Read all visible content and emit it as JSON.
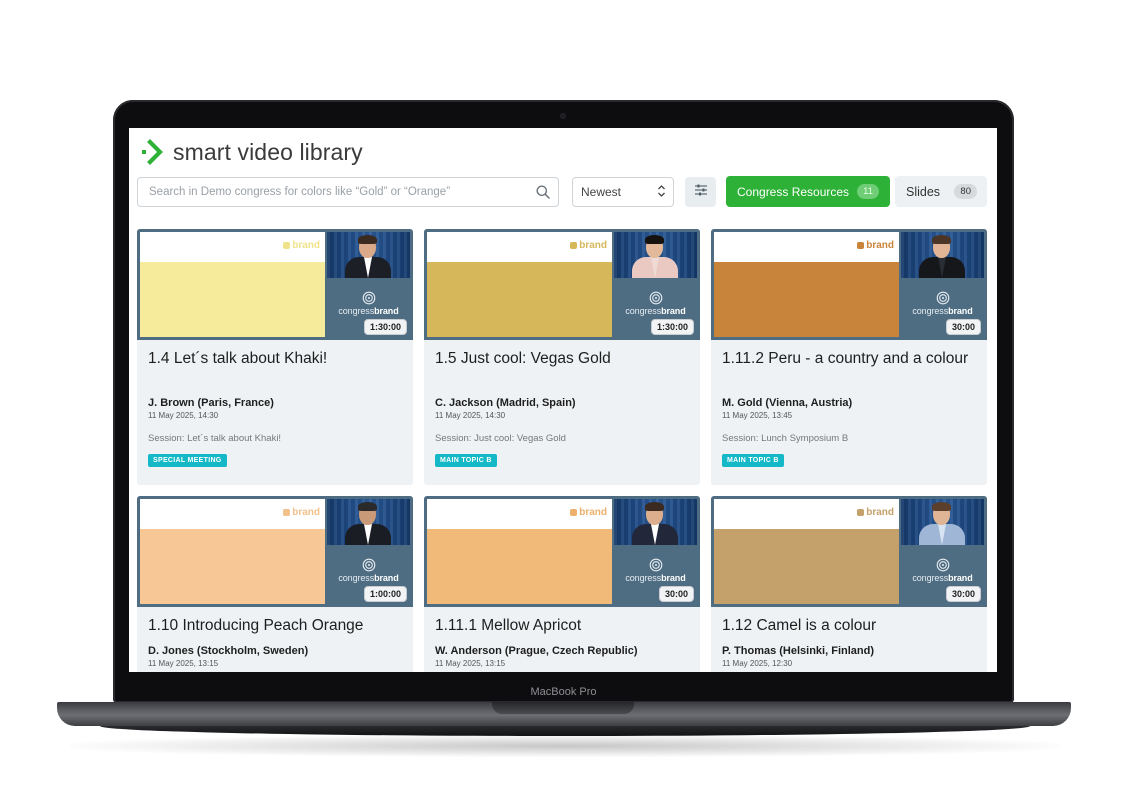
{
  "app": {
    "logo_text": "smart video library",
    "brand_color": "#2db136"
  },
  "device": {
    "label": "MacBook Pro"
  },
  "toolbar": {
    "search_placeholder": "Search in Demo congress for colors like “Gold” or “Orange”",
    "sort_value": "Newest",
    "tabs": [
      {
        "label": "Congress Resources",
        "count": "11",
        "active": true
      },
      {
        "label": "Slides",
        "count": "80",
        "active": false
      }
    ]
  },
  "cards": [
    {
      "title": "1.4 Let´s talk about Khaki!",
      "speaker": "J. Brown (Paris, France)",
      "date": "11 May 2025, 14:30",
      "session": "Session: Let´s talk about Khaki!",
      "tag": "SPECIAL MEETING",
      "duration": "1:30:00",
      "slide_brand": "brand",
      "swatch": "#f5eb9b",
      "brand_accent": "#efe28a",
      "presenter": {
        "skin": "#d9a98a",
        "hair": "#3b2a20",
        "suit": "#1c1f26",
        "shirt": "#ffffff"
      },
      "cb_prefix": "congress",
      "cb_suffix": "brand"
    },
    {
      "title": "1.5 Just cool: Vegas Gold",
      "speaker": "C. Jackson (Madrid, Spain)",
      "date": "11 May 2025, 14:30",
      "session": "Session: Just cool: Vegas Gold",
      "tag": "MAIN TOPIC B",
      "duration": "1:30:00",
      "slide_brand": "brand",
      "swatch": "#d6b85a",
      "brand_accent": "#d6b85a",
      "presenter": {
        "skin": "#e2b99a",
        "hair": "#161210",
        "suit": "#e9c9c2",
        "shirt": "#f0dad5"
      },
      "cb_prefix": "congress",
      "cb_suffix": "brand"
    },
    {
      "title": "1.11.2 Peru - a country and a colour",
      "speaker": "M. Gold (Vienna, Austria)",
      "date": "11 May 2025, 13:45",
      "session": "Session: Lunch Symposium B",
      "tag": "MAIN TOPIC B",
      "duration": "30:00",
      "slide_brand": "brand",
      "swatch": "#c8843a",
      "brand_accent": "#c8843a",
      "presenter": {
        "skin": "#e1b596",
        "hair": "#4a3526",
        "suit": "#15171b",
        "shirt": "#2a2d33"
      },
      "cb_prefix": "congress",
      "cb_suffix": "brand"
    },
    {
      "title": "1.10 Introducing Peach Orange",
      "speaker": "D. Jones (Stockholm, Sweden)",
      "date": "11 May 2025, 13:15",
      "session": "",
      "tag": "",
      "duration": "1:00:00",
      "slide_brand": "brand",
      "swatch": "#f7c795",
      "brand_accent": "#f2c08a",
      "presenter": {
        "skin": "#c99a78",
        "hair": "#2a2a2a",
        "suit": "#1a1d24",
        "shirt": "#ffffff"
      },
      "cb_prefix": "congress",
      "cb_suffix": "brand"
    },
    {
      "title": "1.11.1 Mellow Apricot",
      "speaker": "W. Anderson (Prague, Czech Republic)",
      "date": "11 May 2025, 13:15",
      "session": "",
      "tag": "",
      "duration": "30:00",
      "slide_brand": "brand",
      "swatch": "#f1ba79",
      "brand_accent": "#edb06c",
      "presenter": {
        "skin": "#dcae8e",
        "hair": "#3a2a20",
        "suit": "#22283a",
        "shirt": "#ffffff"
      },
      "cb_prefix": "congress",
      "cb_suffix": "brand"
    },
    {
      "title": "1.12 Camel is a colour",
      "speaker": "P. Thomas (Helsinki, Finland)",
      "date": "11 May 2025, 12:30",
      "session": "",
      "tag": "",
      "duration": "30:00",
      "slide_brand": "brand",
      "swatch": "#c4a06a",
      "brand_accent": "#c4a06a",
      "presenter": {
        "skin": "#e0b595",
        "hair": "#5b3f2a",
        "suit": "#9fb6d6",
        "shirt": "#d7e3f2"
      },
      "cb_prefix": "congress",
      "cb_suffix": "brand"
    }
  ]
}
